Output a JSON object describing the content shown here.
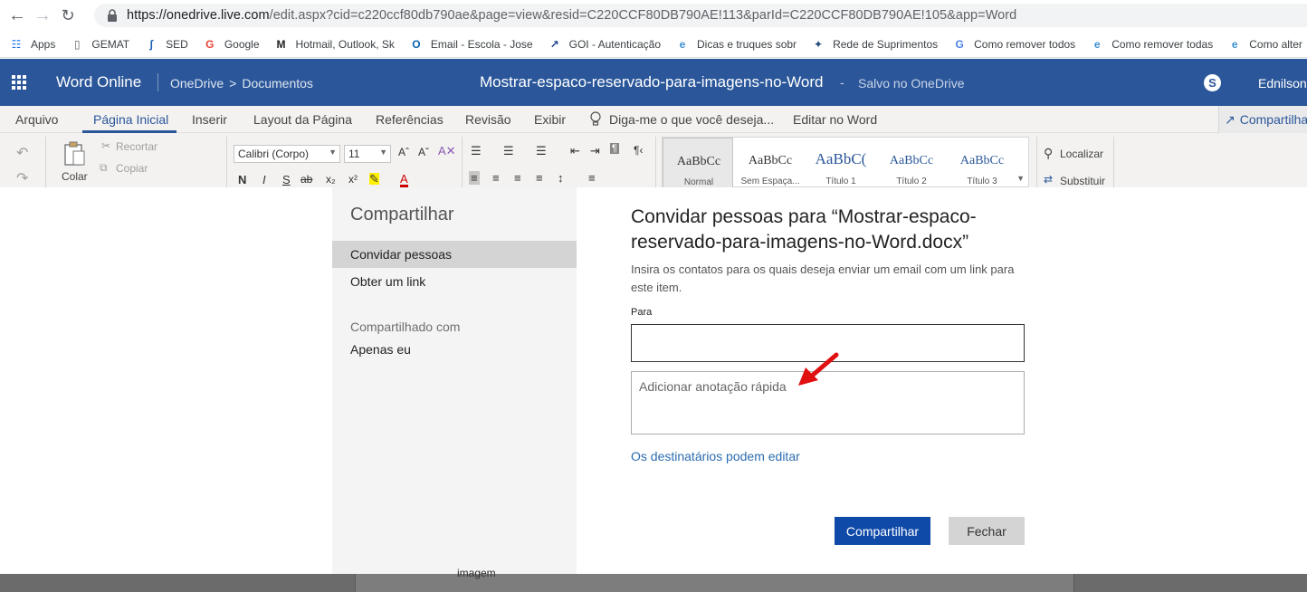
{
  "browser": {
    "url_main": "https://onedrive.live.com",
    "url_path": "/edit.aspx?cid=c220ccf80db790ae&page=view&resid=C220CCF80DB790AE!113&parId=C220CCF80DB790AE!105&app=Word",
    "bookmarks": [
      {
        "label": "Apps",
        "icon": "apps-grid-icon"
      },
      {
        "label": "GEMAT",
        "icon": "page-icon"
      },
      {
        "label": "SED",
        "icon": "sed-logo-icon"
      },
      {
        "label": "Google",
        "icon": "google-icon"
      },
      {
        "label": "Hotmail, Outlook, Sk",
        "icon": "msn-icon"
      },
      {
        "label": "Email - Escola - Jose",
        "icon": "outlook-icon"
      },
      {
        "label": "GOI - Autenticação",
        "icon": "goi-icon"
      },
      {
        "label": "Dicas e truques sobr",
        "icon": "edge-icon"
      },
      {
        "label": "Rede de Suprimentos",
        "icon": "puzzle-icon"
      },
      {
        "label": "Como remover todos",
        "icon": "translate-icon"
      },
      {
        "label": "Como remover todas",
        "icon": "edge-icon"
      },
      {
        "label": "Como alter",
        "icon": "edge-icon"
      }
    ]
  },
  "suite": {
    "app_name": "Word Online",
    "breadcrumb_root": "OneDrive",
    "breadcrumb_sep": ">",
    "breadcrumb_folder": "Documentos",
    "doc_title": "Mostrar-espaco-reservado-para-imagens-no-Word",
    "dash": "-",
    "save_status": "Salvo no OneDrive",
    "user": "Ednilson",
    "brand_color": "#2b579a"
  },
  "ribbon": {
    "tabs": [
      "Arquivo",
      "Página Inicial",
      "Inserir",
      "Layout da Página",
      "Referências",
      "Revisão",
      "Exibir",
      "Diga-me o que você deseja...",
      "Editar no Word"
    ],
    "share_label": "Compartilhar",
    "paste_label": "Colar",
    "cut_label": "Recortar",
    "copy_label": "Copiar",
    "font_name": "Calibri (Corpo)",
    "font_size": "11",
    "styles": [
      {
        "sample": "AaBbCc",
        "name": "Normal"
      },
      {
        "sample": "AaBbCc",
        "name": "Sem Espaça..."
      },
      {
        "sample": "AaBbC(",
        "name": "Título 1"
      },
      {
        "sample": "AaBbCc",
        "name": "Título 2"
      },
      {
        "sample": "AaBbCc",
        "name": "Título 3"
      }
    ],
    "find_label": "Localizar",
    "replace_label": "Substituir"
  },
  "dialog": {
    "left_title": "Compartilhar",
    "nav_invite": "Convidar pessoas",
    "nav_link": "Obter um link",
    "shared_with_label": "Compartilhado com",
    "shared_with_value": "Apenas eu",
    "title": "Convidar pessoas para “Mostrar-espaco-reservado-para-imagens-no-Word.docx”",
    "description": "Insira os contatos para os quais deseja enviar um email com um link para este item.",
    "to_label": "Para",
    "to_value": "",
    "note_placeholder": "Adicionar anotação rápida",
    "permission_link": "Os destinatários podem editar",
    "share_button": "Compartilhar",
    "close_button": "Fechar",
    "accent_color": "#0f4aa8"
  },
  "background": {
    "page_text": "imagem"
  }
}
